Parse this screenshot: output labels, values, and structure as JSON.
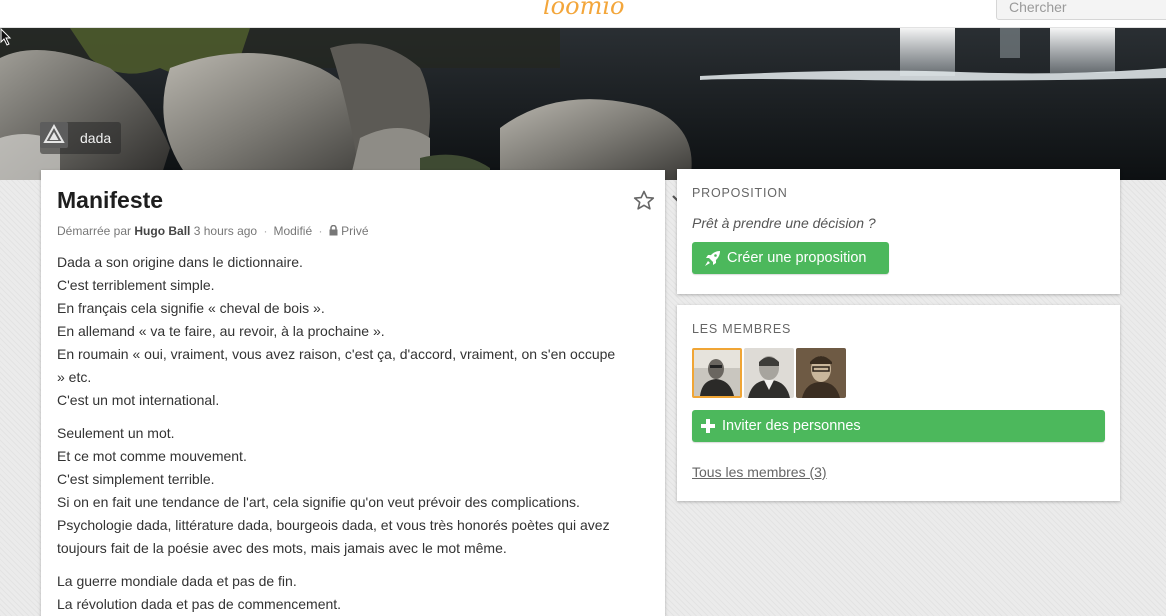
{
  "header": {
    "logo_text": "loomio",
    "search_placeholder": "Chercher"
  },
  "group": {
    "name": "dada"
  },
  "discussion": {
    "title": "Manifeste",
    "meta": {
      "started_by_label": "Démarrée par",
      "author": "Hugo Ball",
      "time": "3 hours ago",
      "edited_label": "Modifié",
      "privacy_label": "Privé"
    },
    "paragraphs": [
      [
        "Dada a son origine dans le dictionnaire.",
        "C'est terriblement simple.",
        "En français cela signifie « cheval de bois ».",
        "En allemand « va te faire, au revoir, à la prochaine ».",
        "En roumain « oui, vraiment, vous avez raison, c'est ça, d'accord, vraiment, on s'en occupe",
        "» etc.",
        "C'est un mot international."
      ],
      [
        "Seulement un mot.",
        "Et ce mot comme mouvement.",
        "C'est simplement terrible.",
        "Si on en fait une tendance de l'art, cela signifie qu'on veut prévoir des complications.",
        "Psychologie dada, littérature dada, bourgeois dada, et vous très honorés poètes qui avez",
        "toujours fait de la poésie avec des mots, mais jamais avec le mot même."
      ],
      [
        "La guerre mondiale dada et pas de fin.",
        "La révolution dada et pas de commencement."
      ]
    ]
  },
  "proposal": {
    "section_title": "PROPOSITION",
    "prompt": "Prêt à prendre une décision ?",
    "create_label": "Créer une proposition"
  },
  "members": {
    "section_title": "LES MEMBRES",
    "invite_label": "Inviter des personnes",
    "all_members_label": "Tous les membres (3)"
  },
  "colors": {
    "accent_green": "#4cb85c",
    "logo_orange": "#f3a63b",
    "selected_avatar_border": "#f0a535"
  }
}
